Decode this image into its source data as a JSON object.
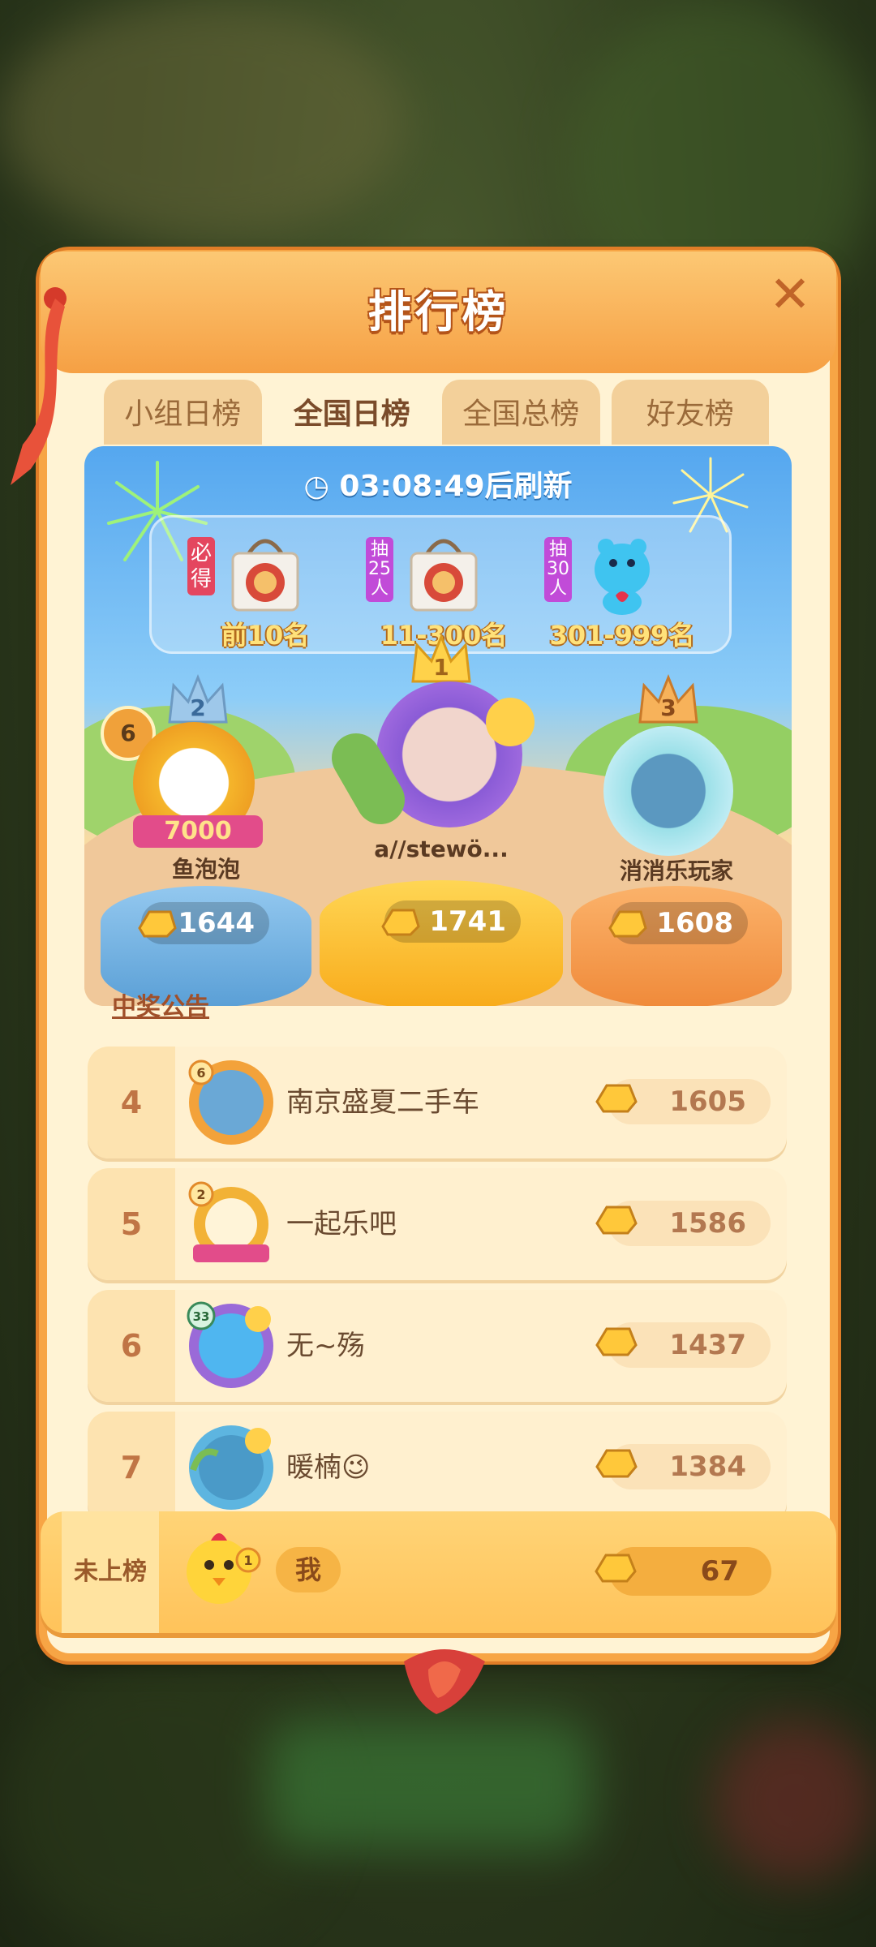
{
  "panel": {
    "title": "排行榜"
  },
  "tabs": [
    {
      "label": "小组日榜"
    },
    {
      "label": "全国日榜",
      "active": true
    },
    {
      "label": "全国总榜"
    },
    {
      "label": "好友榜"
    }
  ],
  "timer": {
    "time": "03:08:49",
    "suffix": "后刷新"
  },
  "rewards": [
    {
      "tag": "必得",
      "label": "前10名",
      "icon": "gift-bag-icon"
    },
    {
      "tag": "抽25人",
      "label": "11-300名",
      "icon": "gift-bag-icon"
    },
    {
      "tag": "抽30人",
      "label": "301-999名",
      "icon": "blue-hippo-plush-icon"
    }
  ],
  "podium": {
    "first": {
      "rank": "1",
      "name": "a//stewö...",
      "score": "1741"
    },
    "second": {
      "rank": "2",
      "name": "鱼泡泡",
      "score": "1644",
      "level": "6"
    },
    "third": {
      "rank": "3",
      "name": "消消乐玩家",
      "score": "1608"
    }
  },
  "notice": {
    "label": "中奖公告"
  },
  "list": [
    {
      "rank": "4",
      "name": "南京盛夏二手车",
      "score": "1605",
      "level": "6"
    },
    {
      "rank": "5",
      "name": "一起乐吧",
      "score": "1586",
      "level": "2"
    },
    {
      "rank": "6",
      "name": "无~殇",
      "score": "1437",
      "level": "33"
    },
    {
      "rank": "7",
      "name": "暖楠😉",
      "score": "1384"
    }
  ],
  "me": {
    "rank": "未上榜",
    "name": "我",
    "score": "67",
    "level": "1"
  },
  "colors": {
    "accent": "#f6a044",
    "panel_bg": "#fff3d4",
    "sky": "#55a7ef"
  }
}
